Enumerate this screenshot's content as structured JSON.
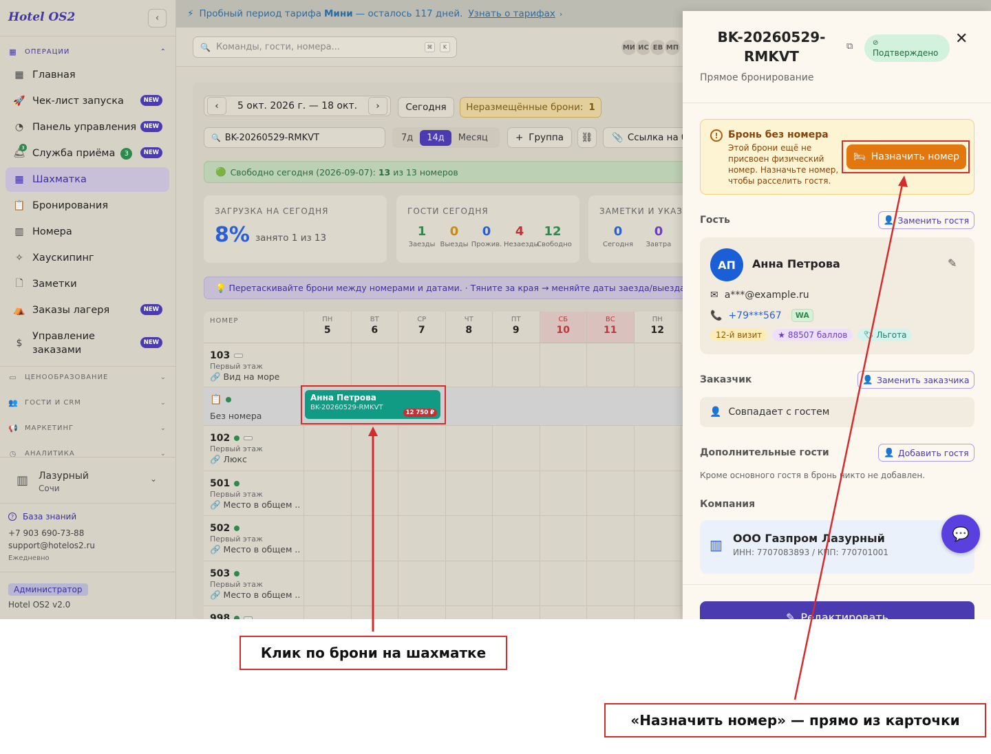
{
  "sidebar": {
    "logo": "Hotel OS2",
    "collapse_icon": "‹",
    "operations_label": "ОПЕРАЦИИ",
    "nav": [
      {
        "label": "Главная",
        "icon": "grid",
        "new": "",
        "count": ""
      },
      {
        "label": "Чек-лист запуска",
        "icon": "rocket",
        "new": "NEW",
        "count": ""
      },
      {
        "label": "Панель управления",
        "icon": "gauge",
        "new": "NEW",
        "count": ""
      },
      {
        "label": "Служба приёма",
        "icon": "bell",
        "new": "NEW",
        "count": "3",
        "mini_badge": "3"
      },
      {
        "label": "Шахматка",
        "icon": "table",
        "new": "",
        "count": ""
      },
      {
        "label": "Бронирования",
        "icon": "clipboard",
        "new": "",
        "count": ""
      },
      {
        "label": "Номера",
        "icon": "building",
        "new": "",
        "count": ""
      },
      {
        "label": "Хаускипинг",
        "icon": "sparkles",
        "new": "",
        "count": ""
      },
      {
        "label": "Заметки",
        "icon": "note",
        "new": "",
        "count": ""
      },
      {
        "label": "Заказы лагеря",
        "icon": "tent",
        "new": "NEW",
        "count": ""
      },
      {
        "label": "Управление заказами",
        "icon": "receipt",
        "new": "NEW",
        "count": ""
      }
    ],
    "sections": [
      "ЦЕНООБРАЗОВАНИЕ",
      "ГОСТИ И CRM",
      "МАРКЕТИНГ",
      "АНАЛИТИКА"
    ],
    "hotel_name": "Лазурный",
    "hotel_city": "Сочи",
    "knowledge_base": "База знаний",
    "phone": "+7 903 690-73-88",
    "email": "support@hotelos2.ru",
    "daily": "Ежедневно",
    "role": "Администратор",
    "version": "Hotel OS2 v2.0"
  },
  "trial": {
    "prefix": "Пробный период тарифа",
    "plan": "Мини",
    "suffix": "— осталось 117 дней.",
    "link": "Узнать о тарифах"
  },
  "topbar": {
    "search_placeholder": "Команды, гости, номера...",
    "kbd1": "⌘",
    "kbd2": "K",
    "avatars": [
      "МИ",
      "ИС",
      "ЕВ",
      "МП"
    ]
  },
  "toolbar": {
    "date_range": "5 окт. 2026 г. — 18 окт.",
    "today": "Сегодня",
    "unassigned_label": "Неразмещённые брони:",
    "unassigned_count": "1",
    "search_value": "BK-20260529-RMKVT",
    "views": [
      "7д",
      "14д",
      "Месяц"
    ],
    "active_view": "14д",
    "group": "Группа",
    "link_btn": "Ссылка на бр"
  },
  "free_today": {
    "prefix": "Свободно сегодня (2026-09-07):",
    "count": "13",
    "suffix": "из 13 номеров"
  },
  "cards": {
    "load_title": "ЗАГРУЗКА НА СЕГОДНЯ",
    "load_value": "8%",
    "load_sub": "занято 1 из 13",
    "guests_title": "ГОСТИ СЕГОДНЯ",
    "guests": [
      {
        "n": "1",
        "l": "Заезды",
        "color": "#2d8a4d"
      },
      {
        "n": "0",
        "l": "Выезды",
        "color": "#c98a12"
      },
      {
        "n": "0",
        "l": "Прожив.",
        "color": "#2a5fd6"
      },
      {
        "n": "4",
        "l": "Незаезды",
        "color": "#c53036"
      },
      {
        "n": "12",
        "l": "Свободно",
        "color": "#2d8a4d"
      }
    ],
    "notes_title": "ЗАМЕТКИ И УКАЗА",
    "notes": [
      {
        "n": "0",
        "l": "Сегодня",
        "color": "#2a5fd6"
      },
      {
        "n": "0",
        "l": "Завтра",
        "color": "#6a3fc4"
      }
    ]
  },
  "tip": "💡 Перетаскивайте брони между номерами и датами.  ·  Тяните за края → меняйте даты заезда/выезда.  ·",
  "grid": {
    "room_header": "НОМЕР",
    "days": [
      {
        "dw": "ПН",
        "dn": "5",
        "we": false
      },
      {
        "dw": "ВТ",
        "dn": "6",
        "we": false
      },
      {
        "dw": "СР",
        "dn": "7",
        "we": false
      },
      {
        "dw": "ЧТ",
        "dn": "8",
        "we": false
      },
      {
        "dw": "ПТ",
        "dn": "9",
        "we": false
      },
      {
        "dw": "СБ",
        "dn": "10",
        "we": true
      },
      {
        "dw": "ВС",
        "dn": "11",
        "we": true
      },
      {
        "dw": "ПН",
        "dn": "12",
        "we": false
      }
    ],
    "rooms": [
      {
        "num": "103",
        "floor": "Первый этаж",
        "type": "Вид на море",
        "dot": false,
        "rect": true
      },
      {
        "num": "",
        "floor": "",
        "type": "Без номера",
        "dot": true,
        "rect": false,
        "unassigned": true
      },
      {
        "num": "102",
        "floor": "Первый этаж",
        "type": "Люкс",
        "dot": true,
        "rect": true
      },
      {
        "num": "501",
        "floor": "Первый этаж",
        "type": "Место в общем ...",
        "dot": true,
        "rect": false
      },
      {
        "num": "502",
        "floor": "Первый этаж",
        "type": "Место в общем ...",
        "dot": true,
        "rect": false
      },
      {
        "num": "503",
        "floor": "Первый этаж",
        "type": "Место в общем ...",
        "dot": true,
        "rect": false
      },
      {
        "num": "998",
        "floor": "",
        "type": "",
        "dot": true,
        "rect": true
      }
    ],
    "booking": {
      "name": "Анна Петрова",
      "code": "BK-20260529-RMKVT",
      "price": "12 750 ₽"
    }
  },
  "panel": {
    "id": "BK-20260529-RMKVT",
    "status": "Подтверждено",
    "source": "Прямое бронирование",
    "warning_title": "Бронь без номера",
    "warning_text": "Этой брони ещё не присвоен физический номер. Назначьте номер, чтобы расселить гостя.",
    "assign": "Назначить номер",
    "guest_label": "Гость",
    "replace_guest": "Заменить гостя",
    "guest_initials": "АП",
    "guest_name": "Анна Петрова",
    "guest_email": "a***@example.ru",
    "guest_phone": "+79***567",
    "wa": "WA",
    "tags": [
      {
        "t": "12-й визит",
        "bg": "#fdecb5",
        "fg": "#8a5a08"
      },
      {
        "t": "★ 88507 баллов",
        "bg": "#eee0fb",
        "fg": "#6a3fc4"
      },
      {
        "t": "🏷 Льгота",
        "bg": "#d5f2ec",
        "fg": "#1f7a6a"
      }
    ],
    "customer_label": "Заказчик",
    "replace_customer": "Заменить заказчика",
    "customer_value": "Совпадает с гостем",
    "extra_label": "Дополнительные гости",
    "add_guest": "Добавить гостя",
    "extra_text": "Кроме основного гостя в бронь никто не добавлен.",
    "company_label": "Компания",
    "company_name": "ООО Газпром Лазурный",
    "company_details": "ИНН: 7707083893 / КПП: 770701001",
    "edit": "Редактировать"
  },
  "annotations": {
    "click_booking": "Клик по брони на шахматке",
    "assign_room": "«Назначить номер» — прямо из карточки"
  }
}
